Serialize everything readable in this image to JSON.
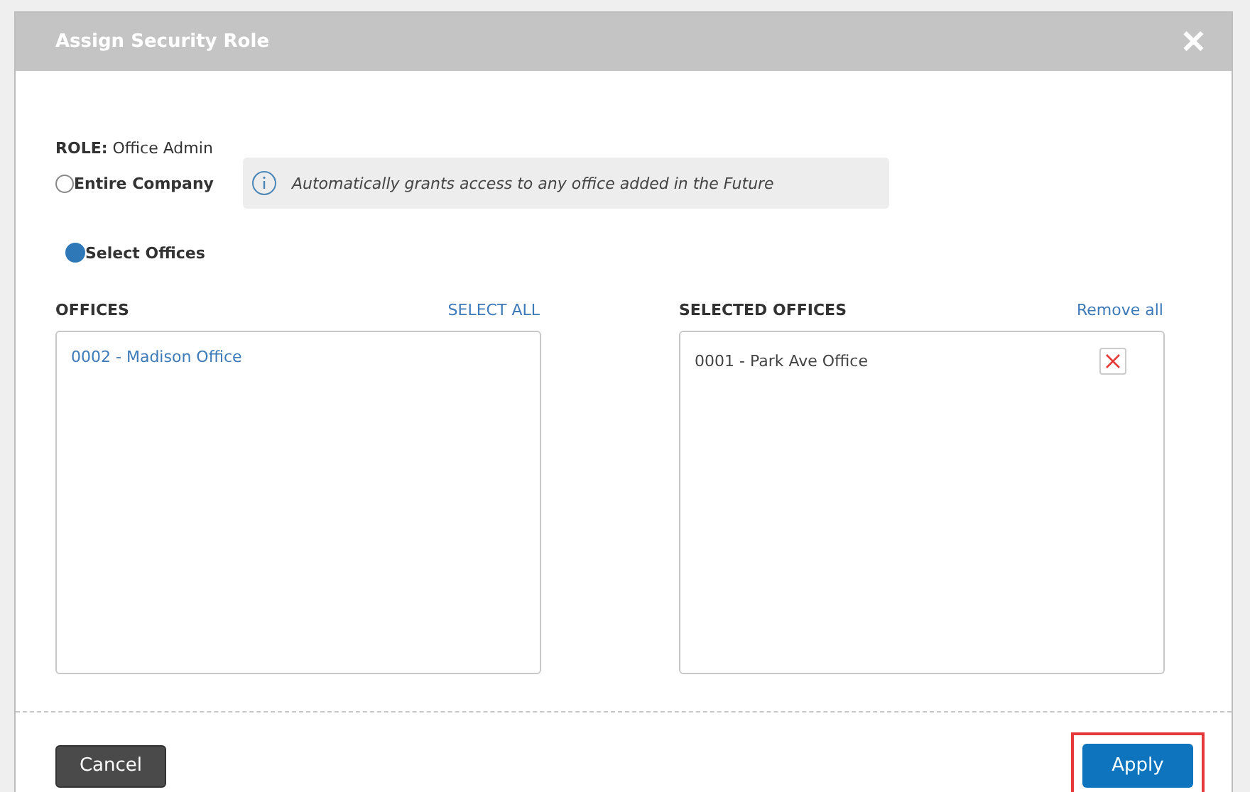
{
  "dialog": {
    "title": "Assign Security Role",
    "close": "✕"
  },
  "role": {
    "label": "ROLE:",
    "value": "Office Admin"
  },
  "scope_options": [
    {
      "label": "Entire Company",
      "selected": false
    },
    {
      "label": "Select Offices",
      "selected": true
    }
  ],
  "info_note": "Automatically grants access to any office added in the Future",
  "offices": {
    "heading": "OFFICES",
    "action": "SELECT ALL",
    "items": [
      "0002 - Madison Office"
    ]
  },
  "selected_offices": {
    "heading": "SELECTED OFFICES",
    "action": "Remove all",
    "items": [
      "0001 - Park Ave Office"
    ]
  },
  "footer": {
    "cancel": "Cancel",
    "apply": "Apply",
    "apply_highlighted": true
  }
}
